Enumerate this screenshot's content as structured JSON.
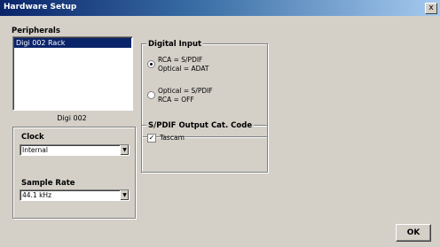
{
  "window": {
    "title": "Hardware Setup",
    "close_label": "x"
  },
  "peripherals": {
    "label": "Peripherals",
    "items": [
      "Digi 002 Rack"
    ],
    "selected_index": 0,
    "caption": "Digi 002"
  },
  "clock": {
    "label": "Clock",
    "value": "Internal"
  },
  "sample_rate": {
    "label": "Sample Rate",
    "value": "44.1 kHz"
  },
  "digital_input": {
    "label": "Digital Input",
    "options": [
      {
        "line1": "RCA      = S/PDIF",
        "line2": "Optical  = ADAT",
        "selected": true
      },
      {
        "line1": "Optical  = S/PDIF",
        "line2": "RCA      = OFF",
        "selected": false
      }
    ]
  },
  "spdif": {
    "label": "S/PDIF Output Cat. Code",
    "checkbox_label": "Tascam",
    "checked": true
  },
  "ok_label": "OK"
}
